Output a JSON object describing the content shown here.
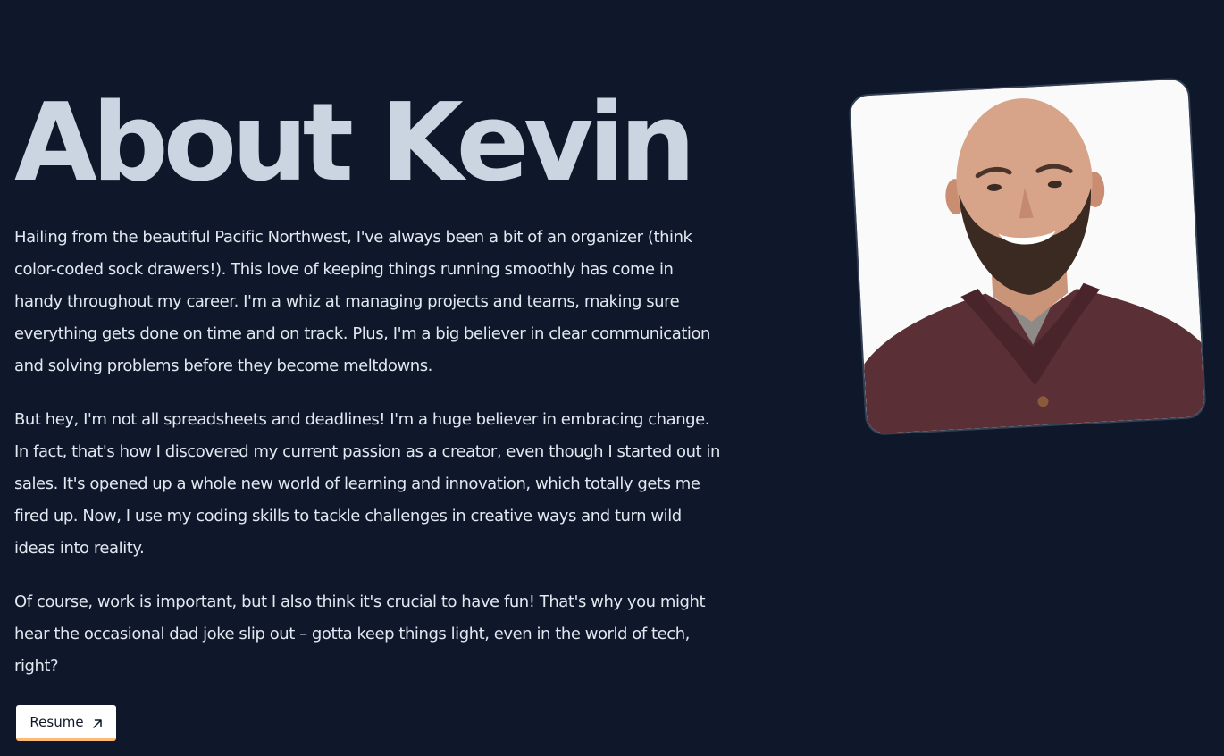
{
  "page": {
    "title": "About Kevin",
    "paragraphs": [
      "Hailing from the beautiful Pacific Northwest, I've always been a bit of an organizer (think color-coded sock drawers!). This love of keeping things running smoothly has come in handy throughout my career. I'm a whiz at managing projects and teams, making sure everything gets done on time and on track. Plus, I'm a big believer in clear communication and solving problems before they become meltdowns.",
      "But hey, I'm not all spreadsheets and deadlines! I'm a huge believer in embracing change. In fact, that's how I discovered my current passion as a creator, even though I started out in sales. It's opened up a whole new world of learning and innovation, which totally gets me fired up. Now, I use my coding skills to tackle challenges in creative ways and turn wild ideas into reality.",
      "Of course, work is important, but I also think it's crucial to have fun! That's why you might hear the occasional dad joke slip out – gotta keep things light, even in the world of tech, right?"
    ],
    "resume_button": {
      "label": "Resume",
      "icon": "arrow-up-right-icon"
    },
    "photo": {
      "icon": "portrait-photo"
    }
  },
  "colors": {
    "background": "#0f172a",
    "heading": "#cbd5e1",
    "body_text": "#e2e8f0",
    "button_bg": "#ffffff",
    "button_accent": "#fdba74"
  }
}
